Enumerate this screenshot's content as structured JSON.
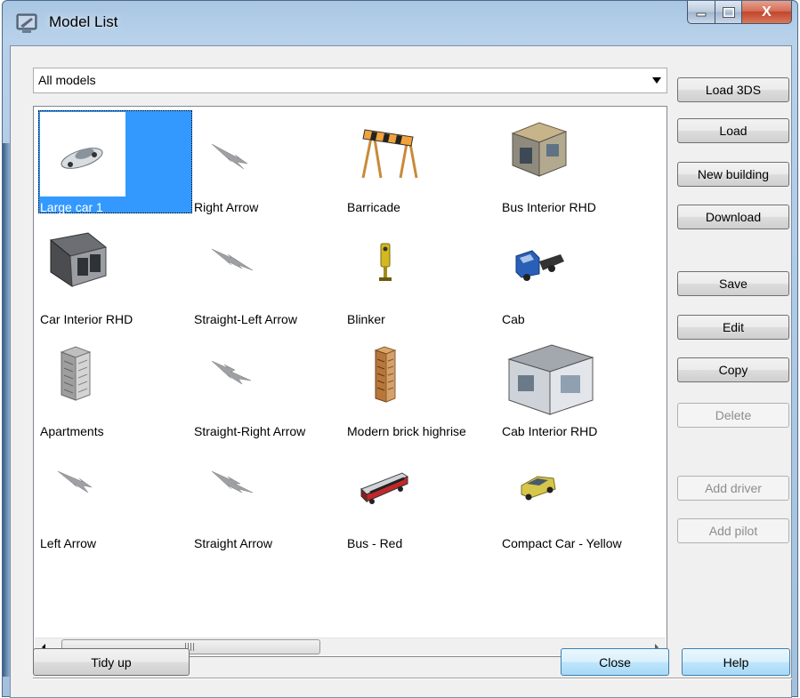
{
  "window": {
    "title": "Model List",
    "close_glyph": "X"
  },
  "filter": {
    "selected": "All models"
  },
  "models": [
    {
      "label": "Large car 1",
      "icon": "white-car-icon",
      "selected": true
    },
    {
      "label": "Right Arrow",
      "icon": "arrow-icon"
    },
    {
      "label": "Barricade",
      "icon": "barricade-icon"
    },
    {
      "label": "Bus Interior RHD",
      "icon": "bus-interior-icon"
    },
    {
      "label": "Car Interior RHD",
      "icon": "car-interior-icon"
    },
    {
      "label": "Straight-Left Arrow",
      "icon": "arrow-icon"
    },
    {
      "label": "Blinker",
      "icon": "blinker-icon"
    },
    {
      "label": "Cab",
      "icon": "truck-cab-icon"
    },
    {
      "label": "Apartments",
      "icon": "apartment-building-icon"
    },
    {
      "label": "Straight-Right Arrow",
      "icon": "arrow-icon"
    },
    {
      "label": "Modern brick highrise",
      "icon": "highrise-building-icon"
    },
    {
      "label": "Cab Interior RHD",
      "icon": "cab-interior-icon"
    },
    {
      "label": "Left Arrow",
      "icon": "arrow-icon"
    },
    {
      "label": "Straight Arrow",
      "icon": "arrow-icon"
    },
    {
      "label": "Bus - Red",
      "icon": "red-bus-icon"
    },
    {
      "label": "Compact Car - Yellow",
      "icon": "yellow-car-icon"
    }
  ],
  "scrollbar": {
    "grip": "III"
  },
  "side_buttons": {
    "load_3ds": "Load 3DS",
    "load": "Load",
    "new_building": "New building",
    "download": "Download",
    "save": "Save",
    "edit": "Edit",
    "copy": "Copy",
    "delete": "Delete",
    "add_driver": "Add driver",
    "add_pilot": "Add pilot"
  },
  "bottom_buttons": {
    "tidy_up": "Tidy up",
    "close": "Close",
    "help": "Help"
  }
}
